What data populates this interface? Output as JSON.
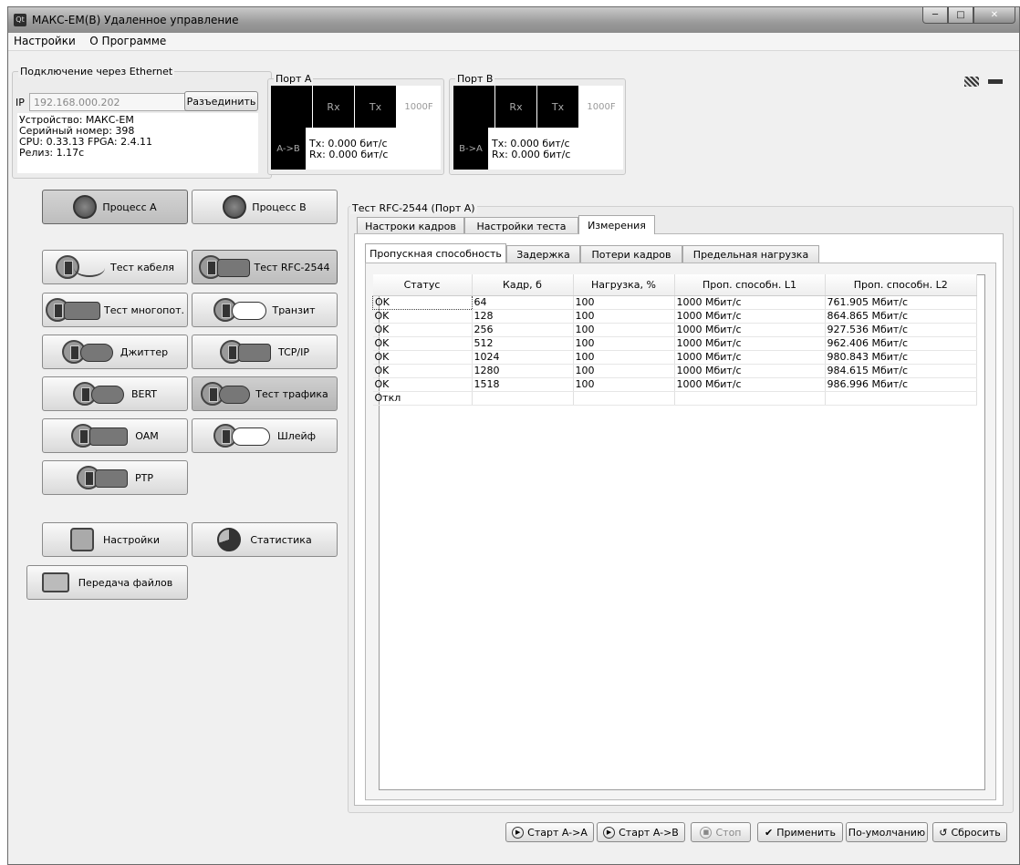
{
  "window": {
    "title": "МАКС-ЕМ(В) Удаленное управление",
    "app_icon": "Qt",
    "controls": [
      "minimize",
      "maximize",
      "close"
    ]
  },
  "menu": [
    "Настройки",
    "О Программе"
  ],
  "connection": {
    "group_title": "Подключение через Ethernet",
    "ip_label": "IP",
    "ip_value": "192.168.000.202",
    "disconnect_label": "Разъединить",
    "info": [
      "Устройство: МАКС-ЕМ",
      "Серийный номер: 398",
      "CPU: 0.33.13 FPGA: 2.4.11",
      "Релиз: 1.17c"
    ]
  },
  "port_a": {
    "title": "Порт A",
    "rx": "Rx",
    "tx": "Tx",
    "speed": "1000F",
    "dir": "A->B",
    "tx_rate": "Tx: 0.000 бит/с",
    "rx_rate": "Rx: 0.000 бит/с"
  },
  "port_b": {
    "title": "Порт B",
    "rx": "Rx",
    "tx": "Tx",
    "speed": "1000F",
    "dir": "B->A",
    "tx_rate": "Tx: 0.000 бит/с",
    "rx_rate": "Rx: 0.000 бит/с"
  },
  "process": {
    "a": "Процесс A",
    "b": "Процесс B"
  },
  "tests": {
    "cable": "Тест кабеля",
    "rfc": "Тест RFC-2544",
    "multistream": "Тест многопот.",
    "transit": "Транзит",
    "jitter": "Джиттер",
    "tcpip": "TCP/IP",
    "bert": "BERT",
    "traffic": "Тест трафика",
    "oam": "OAM",
    "loop": "Шлейф",
    "ptp": "PTP"
  },
  "tools": {
    "settings": "Настройки",
    "stats": "Статистика",
    "files": "Передача файлов"
  },
  "rfc_panel": {
    "title": "Тест RFC-2544 (Порт A)",
    "tabs": [
      "Настроки кадров",
      "Настройки теста",
      "Измерения"
    ],
    "active_tab": "Измерения",
    "subtabs": [
      "Пропускная способность",
      "Задержка",
      "Потери кадров",
      "Предельная нагрузка"
    ],
    "active_subtab": "Пропускная способность",
    "columns": [
      "Статус",
      "Кадр, б",
      "Нагрузка, %",
      "Проп. способн. L1",
      "Проп. способн. L2"
    ],
    "rows": [
      [
        "OK",
        "64",
        "100",
        "1000 Мбит/с",
        "761.905 Мбит/с"
      ],
      [
        "OK",
        "128",
        "100",
        "1000 Мбит/с",
        "864.865 Мбит/с"
      ],
      [
        "OK",
        "256",
        "100",
        "1000 Мбит/с",
        "927.536 Мбит/с"
      ],
      [
        "OK",
        "512",
        "100",
        "1000 Мбит/с",
        "962.406 Мбит/с"
      ],
      [
        "OK",
        "1024",
        "100",
        "1000 Мбит/с",
        "980.843 Мбит/с"
      ],
      [
        "OK",
        "1280",
        "100",
        "1000 Мбит/с",
        "984.615 Мбит/с"
      ],
      [
        "OK",
        "1518",
        "100",
        "1000 Мбит/с",
        "986.996 Мбит/с"
      ],
      [
        "Откл",
        "",
        "",
        "",
        ""
      ]
    ]
  },
  "bottom": {
    "start_aa": "Старт A->A",
    "start_ab": "Старт A->B",
    "stop": "Стоп",
    "apply": "Применить",
    "default": "По-умолчанию",
    "reset": "Сбросить"
  }
}
